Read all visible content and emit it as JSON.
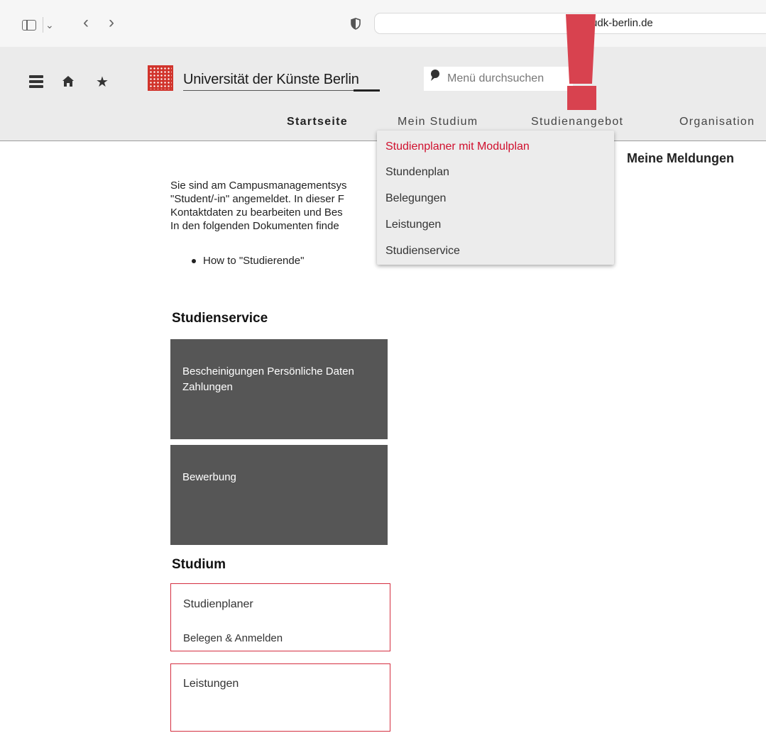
{
  "browser": {
    "url": "my.udk-berlin.de",
    "icons": [
      "sidebar-icon",
      "chevron-down-icon",
      "back-icon",
      "forward-icon",
      "shield-icon"
    ]
  },
  "header": {
    "university_name": "Universität der Künste Berlin",
    "search_placeholder": "Menü durchsuchen",
    "brand_color": "#d1342c",
    "nav": [
      "Startseite",
      "Mein Studium",
      "Studienangebot",
      "Organisation"
    ]
  },
  "dropdown": {
    "items": [
      "Studienplaner mit Modulplan",
      "Stundenplan",
      "Belegungen",
      "Leistungen",
      "Studienservice"
    ],
    "active_color": "#d0102e"
  },
  "main": {
    "messages_title": "Meine Meldungen",
    "intro_lines": [
      "Sie sind am Campusmanagementsys",
      "\"Student/-in\" angemeldet. In dieser F",
      "Kontaktdaten zu bearbeiten und Bes",
      "In den folgenden Dokumenten finde"
    ],
    "bullet": "How to \"Studierende\"",
    "studienservice": {
      "heading": "Studienservice",
      "tile1": "Bescheinigungen Persönliche Daten Zahlungen",
      "tile2": "Bewerbung"
    },
    "studium": {
      "heading": "Studium",
      "tile1_title": "Studienplaner",
      "tile1_sub": "Belegen & Anmelden",
      "tile2_title": "Leistungen"
    }
  },
  "annotation_color": "#d8424f"
}
